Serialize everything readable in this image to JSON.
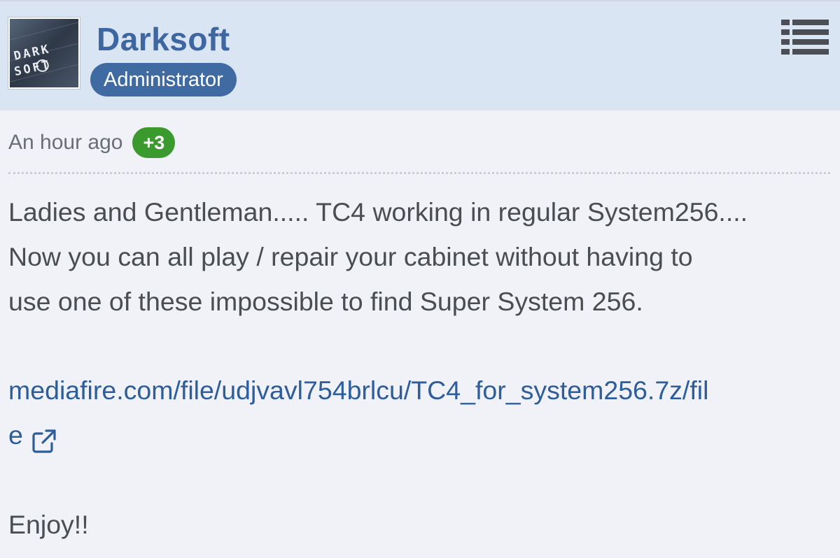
{
  "post": {
    "author": {
      "name": "Darksoft",
      "role": "Administrator",
      "avatar_text_top": "DARK",
      "avatar_text_bottom": "SOFT"
    },
    "menu_icon": "list-menu-icon",
    "timestamp": "An hour ago",
    "reaction_count": "+3",
    "body": {
      "line1": "Ladies and Gentleman..... TC4 working in regular System256....",
      "line2": "Now you can all play / repair your cabinet without having to",
      "line3": "use one of these impossible to find Super System 256.",
      "link_part1": "mediafire.com/file/udjvavl754brlcu/TC4_for_system256.7z/fil",
      "link_part2": "e",
      "link_icon": "external-link-icon",
      "closing": "Enjoy!!"
    }
  },
  "colors": {
    "header_bg": "#dae5f3",
    "page_bg": "#f0f2f8",
    "username": "#3e67a1",
    "role_badge": "#3f6aa2",
    "reaction_badge": "#3b9a2d",
    "link": "#2d5d9a",
    "text": "#4a4d52"
  }
}
